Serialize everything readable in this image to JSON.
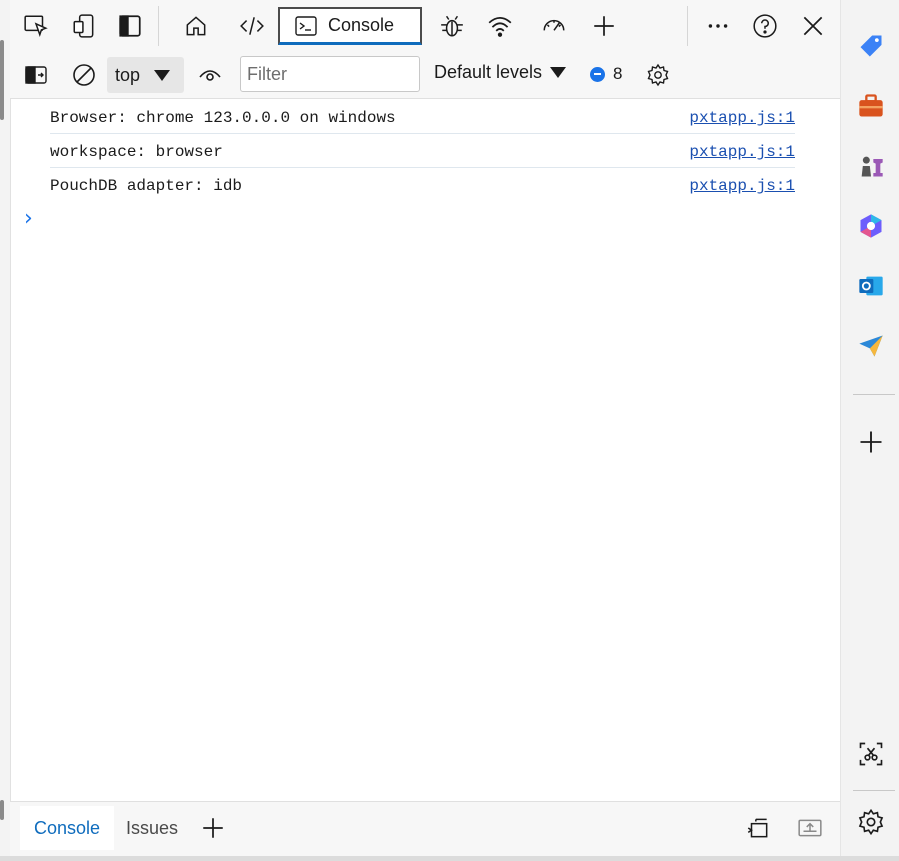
{
  "toolbar": {
    "tabs": [
      {
        "label": "Console"
      }
    ]
  },
  "console_toolbar": {
    "context_value": "top",
    "filter_placeholder": "Filter",
    "filter_value": "",
    "levels_label": "Default levels",
    "message_count": "8"
  },
  "log": {
    "rows": [
      {
        "message": "Browser: chrome 123.0.0.0 on windows",
        "source": "pxtapp.js:1"
      },
      {
        "message": "workspace: browser",
        "source": "pxtapp.js:1"
      },
      {
        "message": "PouchDB adapter: idb",
        "source": "pxtapp.js:1"
      }
    ],
    "prompt_symbol": "›"
  },
  "drawer": {
    "tabs": [
      {
        "label": "Console"
      },
      {
        "label": "Issues"
      }
    ]
  },
  "icons": {
    "toolbar": [
      "inspect-icon",
      "device-emulation-icon",
      "dock-icon",
      "home-icon",
      "elements-icon",
      "console-icon",
      "sources-icon",
      "network-icon",
      "performance-icon",
      "add-tool-icon",
      "more-icon",
      "help-icon",
      "close-icon"
    ],
    "sidebar": [
      "tag-icon",
      "briefcase-icon",
      "chess-icon",
      "copilot-icon",
      "outlook-icon",
      "send-icon",
      "add-icon",
      "screenshot-icon",
      "settings-icon"
    ]
  },
  "colors": {
    "accent": "#0f6cbd",
    "link": "#1a4fb0",
    "message_badge": "#1a73e8"
  }
}
